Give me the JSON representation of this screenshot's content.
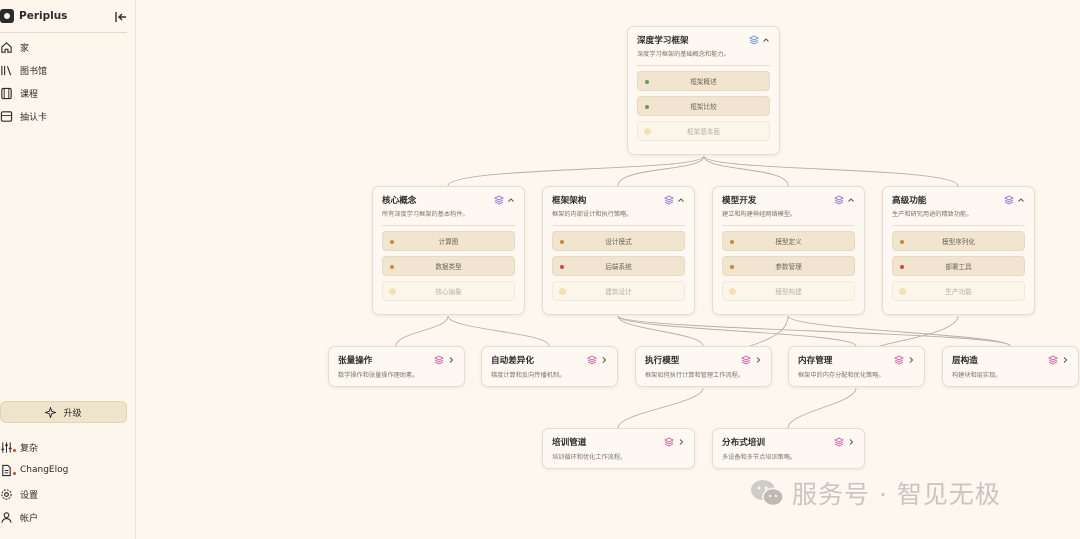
{
  "app": {
    "name": "Periplus"
  },
  "nav": {
    "items": [
      {
        "label": "家",
        "icon": "home-icon"
      },
      {
        "label": "图书馆",
        "icon": "library-icon"
      },
      {
        "label": "课程",
        "icon": "book-icon"
      },
      {
        "label": "抽认卡",
        "icon": "flashcard-icon"
      }
    ],
    "upgrade_label": "升级",
    "bottom": [
      {
        "label": "复杂",
        "icon": "sliders-icon"
      },
      {
        "label": "ChangElog",
        "icon": "document-icon"
      },
      {
        "label": "设置",
        "icon": "gear-icon"
      },
      {
        "label": "帐户",
        "icon": "user-icon"
      }
    ]
  },
  "colors": {
    "accent_green": "#6f9a58",
    "accent_orange": "#c68a3c",
    "accent_red": "#c0504a",
    "stack_blue": "#6b8fd6",
    "stack_purple": "#8c6fd0",
    "stack_pink": "#d4579e"
  },
  "map": {
    "root": {
      "title": "深度学习框架",
      "desc": "深度学习框架的基础概念和能力。",
      "items": [
        "框架概述",
        "框架比较",
        "框架基本面"
      ]
    },
    "level1": [
      {
        "title": "核心概念",
        "desc": "所有深度学习框架的基本构件。",
        "items": [
          "计算图",
          "数据类型",
          "核心抽象"
        ]
      },
      {
        "title": "框架架构",
        "desc": "框架的内部设计和执行策略。",
        "items": [
          "设计模式",
          "后端系统",
          "建筑设计"
        ]
      },
      {
        "title": "模型开发",
        "desc": "建立和构建神经网络模型。",
        "items": [
          "模型定义",
          "参数管理",
          "模型构建"
        ]
      },
      {
        "title": "高级功能",
        "desc": "生产和研究用途的精致功能。",
        "items": [
          "模型序列化",
          "部署工具",
          "生产功能"
        ]
      }
    ],
    "level2": [
      {
        "title": "张量操作",
        "desc": "数学操作和张量操作理助素。"
      },
      {
        "title": "自动差异化",
        "desc": "梯度计算和反向传播机制。"
      },
      {
        "title": "执行模型",
        "desc": "框架如何执行计算和管理工作流程。"
      },
      {
        "title": "内存管理",
        "desc": "框架中的内存分配和优化策略。"
      },
      {
        "title": "层构造",
        "desc": "构建块和层实现。"
      }
    ],
    "level3": [
      {
        "title": "培训管道",
        "desc": "培训循环和优化工作流程。"
      },
      {
        "title": "分布式培训",
        "desc": "多设备和多节点培训策略。"
      }
    ]
  },
  "watermark": {
    "text": "服务号 · 智见无极"
  }
}
